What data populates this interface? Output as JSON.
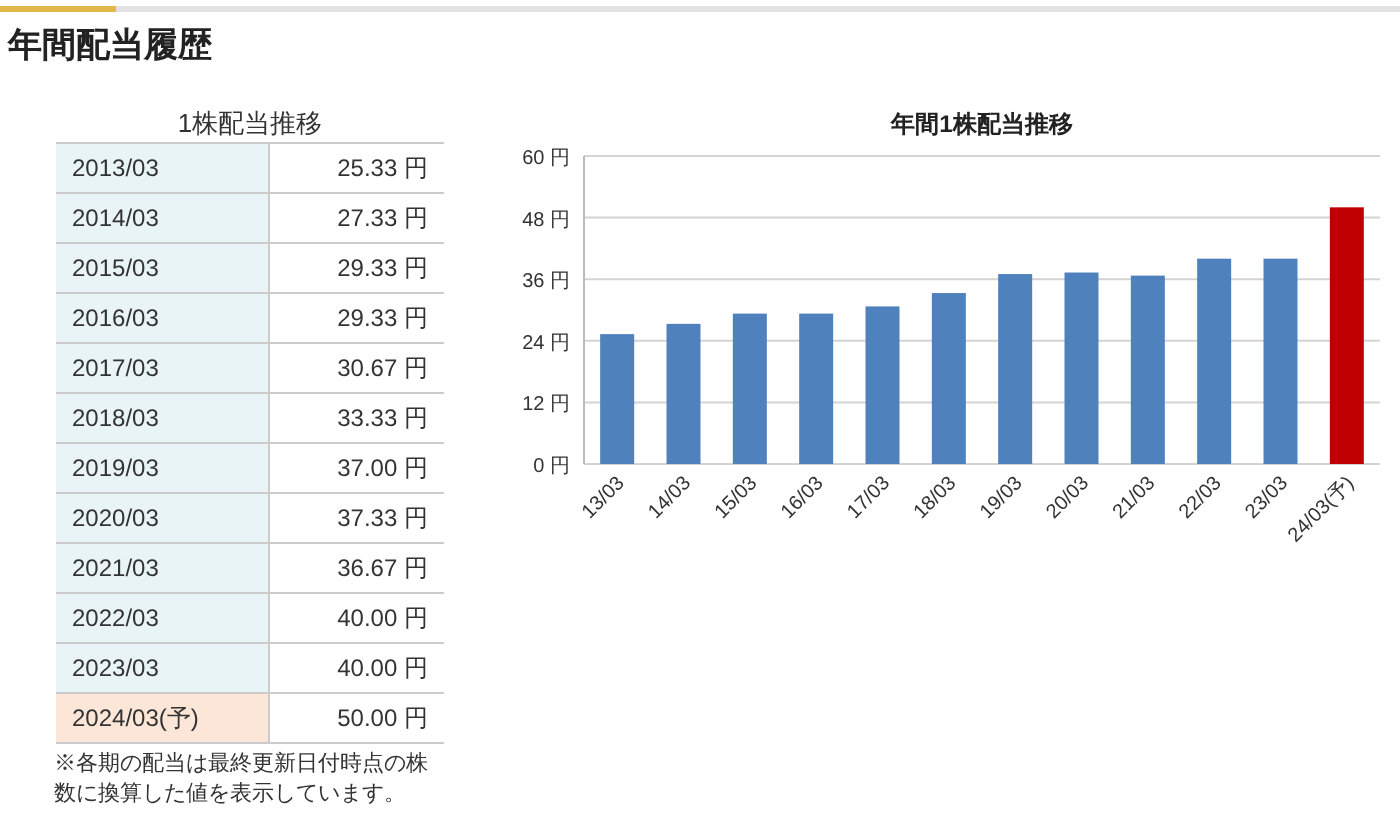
{
  "title": "年間配当履歴",
  "table": {
    "caption": "1株配当推移",
    "rows": [
      {
        "period": "2013/03",
        "dividend": "25.33 円",
        "kind": "actual"
      },
      {
        "period": "2014/03",
        "dividend": "27.33 円",
        "kind": "actual"
      },
      {
        "period": "2015/03",
        "dividend": "29.33 円",
        "kind": "actual"
      },
      {
        "period": "2016/03",
        "dividend": "29.33 円",
        "kind": "actual"
      },
      {
        "period": "2017/03",
        "dividend": "30.67 円",
        "kind": "actual"
      },
      {
        "period": "2018/03",
        "dividend": "33.33 円",
        "kind": "actual"
      },
      {
        "period": "2019/03",
        "dividend": "37.00 円",
        "kind": "actual"
      },
      {
        "period": "2020/03",
        "dividend": "37.33 円",
        "kind": "actual"
      },
      {
        "period": "2021/03",
        "dividend": "36.67 円",
        "kind": "actual"
      },
      {
        "period": "2022/03",
        "dividend": "40.00 円",
        "kind": "actual"
      },
      {
        "period": "2023/03",
        "dividend": "40.00 円",
        "kind": "actual"
      },
      {
        "period": "2024/03(予)",
        "dividend": "50.00 円",
        "kind": "forecast"
      }
    ],
    "note": "※各期の配当は最終更新日付時点の株数に換算した値を表示しています。"
  },
  "chart": {
    "chart_data": {
      "type": "bar",
      "title": "年間1株配当推移",
      "stacked": true,
      "grid": true,
      "categories": [
        "13/03",
        "14/03",
        "15/03",
        "16/03",
        "17/03",
        "18/03",
        "19/03",
        "20/03",
        "21/03",
        "22/03",
        "23/03",
        "24/03(予)"
      ],
      "ylim": [
        0,
        60
      ],
      "yticks": [
        {
          "value": 0,
          "label": "0 円"
        },
        {
          "value": 12,
          "label": "12 円"
        },
        {
          "value": 24,
          "label": "24 円"
        },
        {
          "value": 36,
          "label": "36 円"
        },
        {
          "value": 48,
          "label": "48 円"
        },
        {
          "value": 60,
          "label": "60 円"
        }
      ],
      "series": [
        {
          "color": "#4f81bd",
          "values": [
            25.3,
            27.3,
            29.3,
            29.3,
            30.7,
            33.3,
            37.0,
            37.3,
            36.7,
            40.0,
            40.0,
            null
          ]
        },
        {
          "color": "#c00000",
          "values": [
            null,
            null,
            null,
            null,
            null,
            null,
            null,
            null,
            null,
            null,
            null,
            50.0
          ]
        }
      ]
    }
  }
}
